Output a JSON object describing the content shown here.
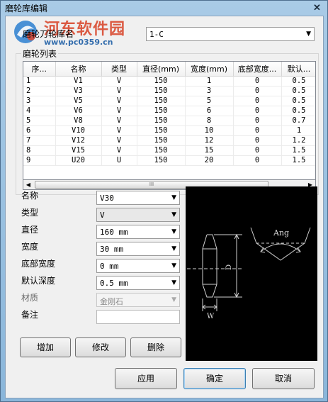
{
  "window": {
    "title": "磨轮库编辑",
    "close_icon": "close-icon"
  },
  "watermark": {
    "name": "河东软件园",
    "url": "www.pc0359.cn"
  },
  "library": {
    "label": "磨轮刀轮库名",
    "value": "1-C"
  },
  "grindlist": {
    "title": "磨轮列表",
    "columns": [
      "序...",
      "名称",
      "类型",
      "直径(mm)",
      "宽度(mm)",
      "底部宽度...",
      "默认..."
    ],
    "rows": [
      [
        "1",
        "V1",
        "V",
        "150",
        "1",
        "0",
        "0.5"
      ],
      [
        "2",
        "V3",
        "V",
        "150",
        "3",
        "0",
        "0.5"
      ],
      [
        "3",
        "V5",
        "V",
        "150",
        "5",
        "0",
        "0.5"
      ],
      [
        "4",
        "V6",
        "V",
        "150",
        "6",
        "0",
        "0.5"
      ],
      [
        "5",
        "V8",
        "V",
        "150",
        "8",
        "0",
        "0.7"
      ],
      [
        "6",
        "V10",
        "V",
        "150",
        "10",
        "0",
        "1"
      ],
      [
        "7",
        "V12",
        "V",
        "150",
        "12",
        "0",
        "1.2"
      ],
      [
        "8",
        "V15",
        "V",
        "150",
        "15",
        "0",
        "1.5"
      ],
      [
        "9",
        "U20",
        "U",
        "150",
        "20",
        "0",
        "1.5"
      ]
    ],
    "scroll_grip": "III"
  },
  "form": {
    "name_label": "名称",
    "name_value": "V30",
    "type_label": "类型",
    "type_value": "V",
    "diameter_label": "直径",
    "diameter_value": "160 mm",
    "width_label": "宽度",
    "width_value": "30 mm",
    "bottom_width_label": "底部宽度",
    "bottom_width_value": "0 mm",
    "default_depth_label": "默认深度",
    "default_depth_value": "0.5 mm",
    "material_label": "材质",
    "material_value": "金刚石",
    "note_label": "备注",
    "note_value": ""
  },
  "preview": {
    "ang_label": "Ang",
    "d_label": "D",
    "w_label": "W"
  },
  "buttons": {
    "add": "增加",
    "modify": "修改",
    "delete": "删除",
    "apply": "应用",
    "ok": "确定",
    "cancel": "取消"
  }
}
